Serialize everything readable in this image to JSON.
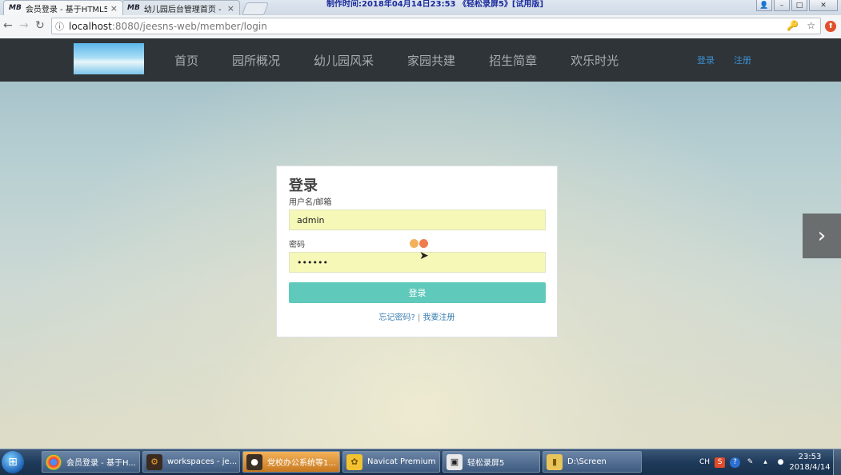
{
  "browser": {
    "tabs": [
      {
        "favicon": "MB",
        "title": "会员登录 - 基于HTML5",
        "close": "×"
      },
      {
        "favicon": "MB",
        "title": "幼儿园后台管理首页 - 基",
        "close": "×"
      }
    ],
    "watermark": "制作时间:2018年04月14日23:53 《轻松录屏5》[试用版]",
    "url_host": "localhost",
    "url_path": ":8080/jeesns-web/member/login",
    "nav": {
      "back": "←",
      "forward": "→",
      "reload": "↻"
    },
    "omni_icons": {
      "info": "ⓘ",
      "key": "🔑",
      "star": "☆"
    },
    "window_buttons": {
      "user": "👤",
      "minimize": "–",
      "maximize": "□",
      "close": "✕"
    }
  },
  "site": {
    "menu": [
      "首页",
      "园所概况",
      "幼儿园风采",
      "家园共建",
      "招生简章",
      "欢乐时光"
    ],
    "auth": {
      "login": "登录",
      "register": "注册"
    },
    "carousel_next": "›"
  },
  "login": {
    "title": "登录",
    "username_label": "用户名/邮箱",
    "username_value": "admin",
    "password_label": "密码",
    "password_value": "••••••",
    "submit": "登录",
    "forgot": "忘记密码?",
    "separator": " | ",
    "register": "我要注册"
  },
  "taskbar": {
    "items": [
      {
        "label": "会员登录 - 基于H...",
        "icon": "chrome-icon"
      },
      {
        "label": "workspaces - je...",
        "icon": "intellij-icon"
      },
      {
        "label": "党校办公系统等1...",
        "icon": "app-icon"
      },
      {
        "label": "Navicat Premium",
        "icon": "navicat-icon"
      },
      {
        "label": "轻松录屏5",
        "icon": "recorder-icon"
      },
      {
        "label": "D:\\Screen",
        "icon": "folder-icon"
      }
    ],
    "tray": {
      "lang": "CH"
    },
    "clock_time": "23:53",
    "clock_date": "2018/4/14"
  }
}
